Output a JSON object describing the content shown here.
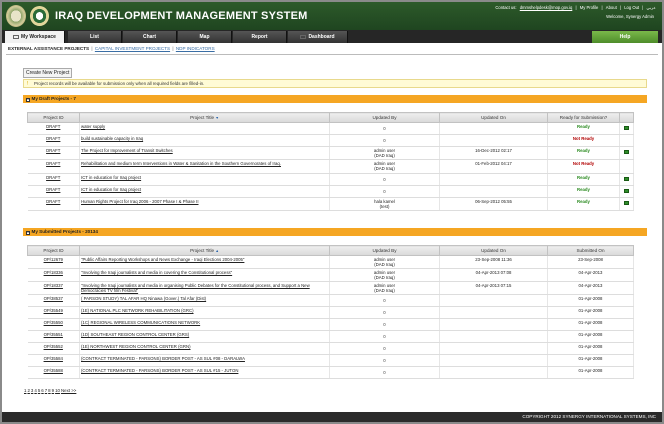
{
  "header": {
    "title": "IRAQ DEVELOPMENT MANAGEMENT SYSTEM",
    "contact_label": "Contact us:",
    "contact_email": "dmmshelpdesk@mop.gov.iq",
    "links": [
      "My Profile",
      "About",
      "Log Out"
    ],
    "arabic_link": "عربي",
    "welcome": "Welcome, Synergy Admin"
  },
  "nav": {
    "tabs": [
      "My Workspace",
      "List",
      "Chart",
      "Map",
      "Report",
      "Dashboard"
    ],
    "help": "Help"
  },
  "subtabs": [
    "EXTERNAL ASSISTANCE PROJECTS",
    "CAPITAL INVESTMENT PROJECTS",
    "NDP INDICATORS"
  ],
  "create_button": "Create New Project",
  "info": "Project records will be available for submission only when all required fields are filled-in.",
  "draft": {
    "title": "My Draft Projects - 7",
    "columns": [
      "Project ID",
      "Project Title",
      "Updated By",
      "Updated On",
      "Ready for Submission?"
    ],
    "rows": [
      {
        "id": "DRAFT",
        "title": "water supply",
        "by1": "",
        "by2": "0",
        "on": "",
        "status": "Ready",
        "ready": true
      },
      {
        "id": "DRAFT",
        "title": "build sustainable capacity in Iraq",
        "by1": "",
        "by2": "0",
        "on": "",
        "status": "Not Ready",
        "ready": false
      },
      {
        "id": "DRAFT",
        "title": "The Project for Improvement of Transit Switches",
        "by1": "admin user",
        "by2": "(DAD Iraq)",
        "on": "16-Dec-2012 02:17",
        "status": "Ready",
        "ready": true
      },
      {
        "id": "DRAFT",
        "title": "Rehabilitation and medium term Interventions in Water & Sanitation in the Southern Governorates of Iraq.",
        "by1": "admin user",
        "by2": "(DAD Iraq)",
        "on": "01-Feb-2012 04:17",
        "status": "Not Ready",
        "ready": false
      },
      {
        "id": "DRAFT",
        "title": "ICT in education for Iraq project",
        "by1": "",
        "by2": "0",
        "on": "",
        "status": "Ready",
        "ready": true
      },
      {
        "id": "DRAFT",
        "title": "ICT in education for Iraq project",
        "by1": "",
        "by2": "0",
        "on": "",
        "status": "Ready",
        "ready": true
      },
      {
        "id": "DRAFT",
        "title": "Human Rights Project for Iraq 2006 - 2007 Phase I & Phase II",
        "by1": "hala kamel",
        "by2": "(test)",
        "on": "06-Sep-2012 05:55",
        "status": "Ready",
        "ready": true
      }
    ]
  },
  "submitted": {
    "title": "My Submitted Projects - 20134",
    "columns": [
      "Project ID",
      "Project Title",
      "Updated By",
      "Updated On",
      "Submitted On"
    ],
    "rows": [
      {
        "id": "OP/12679",
        "title": "\"Public Affairs Reporting Workshops and News Exchange - Iraqi Elections 2004-2005\"",
        "by1": "admin user",
        "by2": "(DAD Iraq)",
        "on": "23-Sep-2008 11:36",
        "sub": "23-Sep-2008"
      },
      {
        "id": "OP/18336",
        "title": "\"Involving the Iraqi journalists and media in covering the Constitutional process\"",
        "by1": "admin user",
        "by2": "(DAD Iraq)",
        "on": "04-Apr-2013 07:08",
        "sub": "04-Apr-2013"
      },
      {
        "id": "OP/18337",
        "title": "\"Involving the Iraqi journalists and media in organising Public Debates for the Constitutional process, and Support a New Democracies TV film Festival\"",
        "by1": "admin user",
        "by2": "(DAD Iraq)",
        "on": "04-Apr-2013 07:15",
        "sub": "04-Apr-2013"
      },
      {
        "id": "OP/38537",
        "title": "( PARSON STUDY) TAL AFAR HQ Ninawa (Gover.) Tal Afar (Dist)",
        "by1": "",
        "by2": "0",
        "on": "",
        "sub": "01-Apr-2008"
      },
      {
        "id": "OP/35549",
        "title": "(1E) NATIONAL PLC NETWORK REHABILITATION (GRC)",
        "by1": "",
        "by2": "0",
        "on": "",
        "sub": "01-Apr-2008"
      },
      {
        "id": "OP/35550",
        "title": "(1C) REGIONAL WIRELESS COMMUNICATIONS NETWORK",
        "by1": "",
        "by2": "0",
        "on": "",
        "sub": "01-Apr-2008"
      },
      {
        "id": "OP/35551",
        "title": "(1D) SOUTHEAST REGION CONTROL CENTER (GRS)",
        "by1": "",
        "by2": "0",
        "on": "",
        "sub": "01-Apr-2008"
      },
      {
        "id": "OP/35552",
        "title": "(1E) NORTHWEST REGION CONTROL CENTER (GRN)",
        "by1": "",
        "by2": "0",
        "on": "",
        "sub": "01-Apr-2008"
      },
      {
        "id": "OP/35584",
        "title": "(CONTRACT TERMINATED - PARSONS) BORDER POST - AS SUL #08 - DARALWA",
        "by1": "",
        "by2": "0",
        "on": "",
        "sub": "01-Apr-2008"
      },
      {
        "id": "OP/35588",
        "title": "(CONTRACT TERMINATED - PARSONS) BORDER POST - AS SUL #15 - JUTON",
        "by1": "",
        "by2": "0",
        "on": "",
        "sub": "01-Apr-2008"
      }
    ]
  },
  "pager": {
    "pages": [
      "1",
      "2",
      "3",
      "4",
      "5",
      "6",
      "7",
      "8",
      "9",
      "10"
    ],
    "next": "Next >>"
  },
  "footer": "COPYRIGHT 2012 SYNERGY INTERNATIONAL SYSTEMS, INC",
  "colors": {
    "header_green": "#2d5a2a",
    "section_orange": "#f5a623",
    "help_green": "#5fa035",
    "ready_green": "#2a8a1f",
    "notready_red": "#b10000"
  },
  "icons": {
    "go": "green-submit-icon",
    "sort_down": "sort-desc-icon",
    "sort_up": "sort-asc-icon",
    "warning": "warning-icon"
  }
}
